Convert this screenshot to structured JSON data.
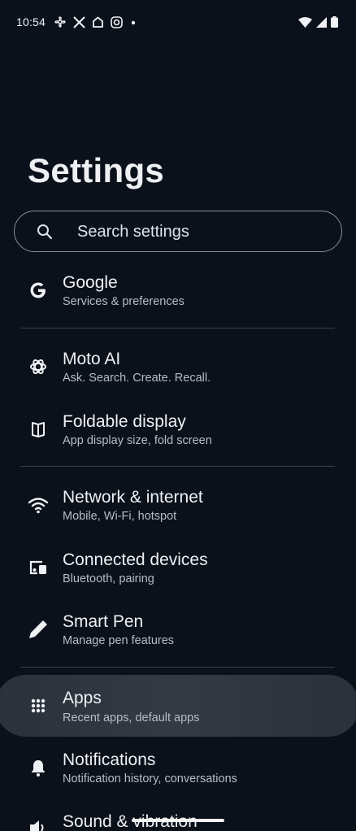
{
  "status_bar": {
    "time": "10:54",
    "left_icons": [
      "fan-icon",
      "x-icon",
      "home-icon",
      "instagram-icon",
      "dot-icon"
    ],
    "right_icons": [
      "wifi-icon",
      "signal-icon",
      "battery-icon"
    ]
  },
  "page": {
    "title": "Settings"
  },
  "search": {
    "placeholder": "Search settings"
  },
  "items": [
    {
      "key": "google",
      "icon": "google-icon",
      "title": "Google",
      "subtitle": "Services & preferences"
    },
    {
      "key": "moto-ai",
      "icon": "moto-ai-icon",
      "title": "Moto AI",
      "subtitle": "Ask. Search. Create. Recall."
    },
    {
      "key": "foldable",
      "icon": "foldable-icon",
      "title": "Foldable display",
      "subtitle": "App display size, fold screen"
    },
    {
      "key": "network",
      "icon": "wifi-icon",
      "title": "Network & internet",
      "subtitle": "Mobile, Wi-Fi, hotspot"
    },
    {
      "key": "connected",
      "icon": "devices-icon",
      "title": "Connected devices",
      "subtitle": "Bluetooth, pairing"
    },
    {
      "key": "pen",
      "icon": "pen-icon",
      "title": "Smart Pen",
      "subtitle": "Manage pen features"
    },
    {
      "key": "apps",
      "icon": "apps-grid-icon",
      "title": "Apps",
      "subtitle": "Recent apps, default apps"
    },
    {
      "key": "notifications",
      "icon": "bell-icon",
      "title": "Notifications",
      "subtitle": "Notification history, conversations"
    },
    {
      "key": "sound",
      "icon": "speaker-icon",
      "title": "Sound & vibration",
      "subtitle": ""
    }
  ],
  "colors": {
    "background": "#0b111a",
    "highlight": "#2e3540",
    "text": "#eef0f4",
    "subtext": "#b8bcc4"
  }
}
